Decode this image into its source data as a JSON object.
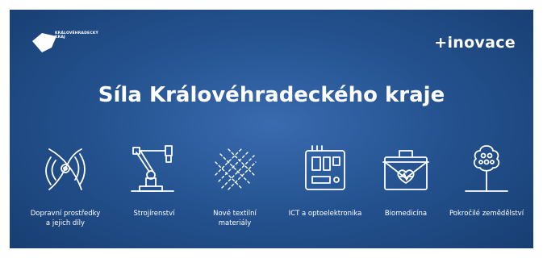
{
  "logo": {
    "text": "KRÁLOVÉHRADECKÝ\nKRAJ",
    "icon": "region-logo-icon"
  },
  "brand": {
    "text": "+inovace"
  },
  "title": "Síla Královéhradeckého kraje",
  "sectors": [
    {
      "label": "Dopravní prostředky\na jejich díly",
      "icon": "propeller-icon"
    },
    {
      "label": "Strojírenství",
      "icon": "robotic-arm-icon"
    },
    {
      "label": "Nové textilní\nmateriály",
      "icon": "textile-mesh-icon"
    },
    {
      "label": "ICT a optoelektronika",
      "icon": "circuit-board-icon"
    },
    {
      "label": "Biomedicína",
      "icon": "medical-case-icon"
    },
    {
      "label": "Pokročilé zemědělství",
      "icon": "tree-icon"
    }
  ],
  "colors": {
    "background": "#24528f",
    "foreground": "#ffffff"
  }
}
